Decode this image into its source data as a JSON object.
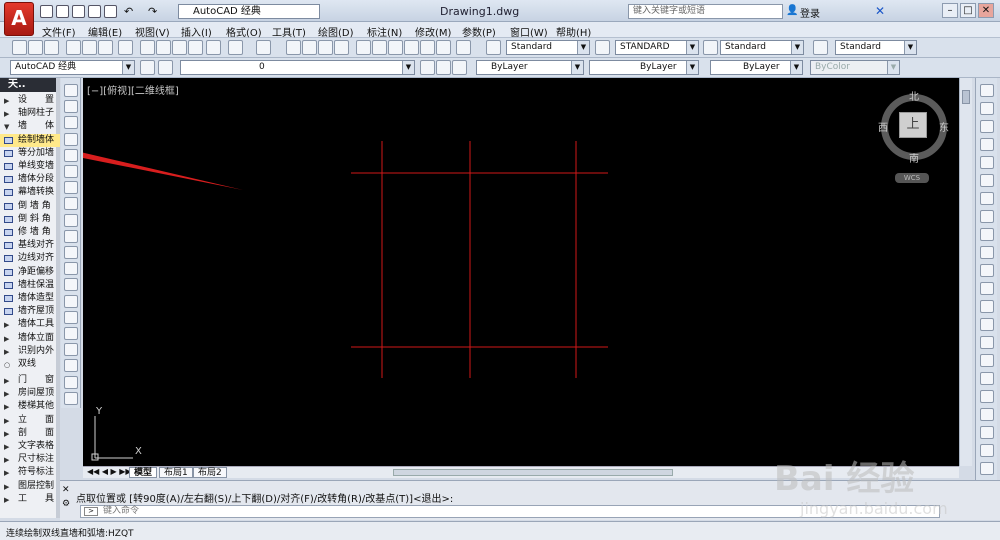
{
  "titlebar": {
    "workspace": "AutoCAD 经典",
    "document_title": "Drawing1.dwg",
    "search_placeholder": "键入关键字或短语",
    "login": "登录"
  },
  "menu": [
    "文件(F)",
    "编辑(E)",
    "视图(V)",
    "插入(I)",
    "格式(O)",
    "工具(T)",
    "绘图(D)",
    "标注(N)",
    "修改(M)",
    "参数(P)",
    "窗口(W)",
    "帮助(H)"
  ],
  "styles_toolbar": {
    "text_style": "Standard",
    "dim_style": "STANDARD",
    "table_style": "Standard",
    "multileader_style": "Standard"
  },
  "layer_toolbar": {
    "workspace": "AutoCAD 经典",
    "layer": "0",
    "color": "ByLayer",
    "linetype": "ByLayer",
    "lineweight": "ByLayer",
    "plot_style": "ByColor"
  },
  "left_panel": {
    "header": "天..",
    "items": [
      {
        "label": "设　　置",
        "kind": "group"
      },
      {
        "label": "轴网柱子",
        "kind": "group"
      },
      {
        "label": "墙　　体",
        "kind": "group-open"
      },
      {
        "label": "绘制墙体",
        "kind": "item",
        "selected": true
      },
      {
        "label": "等分加墙",
        "kind": "item"
      },
      {
        "label": "单线变墙",
        "kind": "item"
      },
      {
        "label": "墙体分段",
        "kind": "item"
      },
      {
        "label": "幕墙转换",
        "kind": "item"
      },
      {
        "label": "倒 墙 角",
        "kind": "item"
      },
      {
        "label": "倒 斜 角",
        "kind": "item"
      },
      {
        "label": "修 墙 角",
        "kind": "item"
      },
      {
        "label": "基线对齐",
        "kind": "item"
      },
      {
        "label": "边线对齐",
        "kind": "item"
      },
      {
        "label": "净距偏移",
        "kind": "item"
      },
      {
        "label": "墙柱保温",
        "kind": "item"
      },
      {
        "label": "墙体造型",
        "kind": "item"
      },
      {
        "label": "墙齐屋顶",
        "kind": "item"
      },
      {
        "label": "墙体工具",
        "kind": "group"
      },
      {
        "label": "墙体立面",
        "kind": "group"
      },
      {
        "label": "识别内外",
        "kind": "group"
      },
      {
        "label": "双线",
        "kind": "tab"
      },
      {
        "label": "门　　窗",
        "kind": "group"
      },
      {
        "label": "房间屋顶",
        "kind": "group"
      },
      {
        "label": "楼梯其他",
        "kind": "group"
      },
      {
        "label": "立　　面",
        "kind": "group"
      },
      {
        "label": "剖　　面",
        "kind": "group"
      },
      {
        "label": "文字表格",
        "kind": "group"
      },
      {
        "label": "尺寸标注",
        "kind": "group"
      },
      {
        "label": "符号标注",
        "kind": "group"
      },
      {
        "label": "图层控制",
        "kind": "group"
      },
      {
        "label": "工　　具",
        "kind": "group"
      }
    ]
  },
  "canvas": {
    "view_label": "[−][俯视][二维线框]",
    "viewcube": {
      "north": "北",
      "south": "南",
      "east": "东",
      "west": "西",
      "top": "上",
      "wcs": "WCS"
    },
    "ucs": {
      "x": "X",
      "y": "Y"
    },
    "line_color": "#d01818"
  },
  "layout_tabs": [
    "模型",
    "布局1",
    "布局2"
  ],
  "command": {
    "history": "点取位置或 [转90度(A)/左右翻(S)/上下翻(D)/对齐(F)/改转角(R)/改基点(T)]<退出>:",
    "placeholder": "键入命令"
  },
  "status": "连续绘制双线直墙和弧墙:HZQT",
  "watermark": {
    "brand": "Bai 经验",
    "url": "jingyan.baidu.com"
  }
}
